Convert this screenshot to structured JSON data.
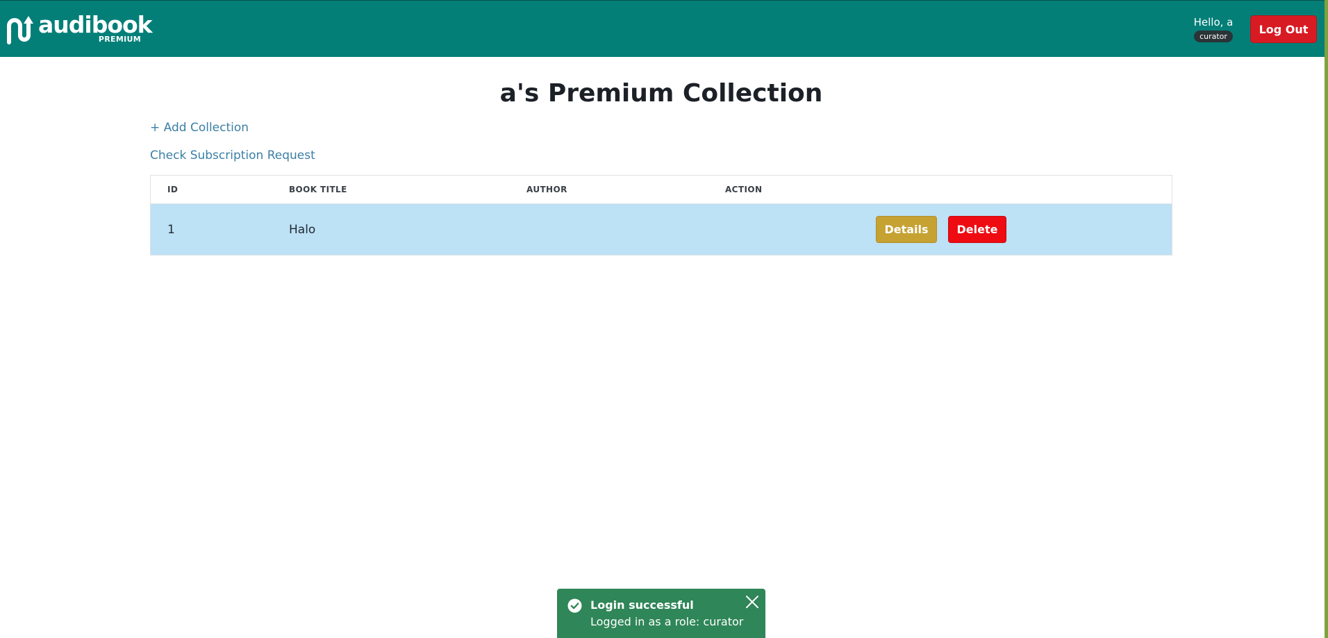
{
  "header": {
    "brand_name": "audibook",
    "brand_sub": "PREMIUM",
    "greeting": "Hello, a",
    "role_badge": "curator",
    "logout_label": "Log Out"
  },
  "main": {
    "title": "a's Premium Collection",
    "add_collection_link": "+ Add Collection",
    "check_subscription_link": "Check Subscription Request"
  },
  "table": {
    "columns": [
      "ID",
      "BOOK TITLE",
      "AUTHOR",
      "ACTION"
    ],
    "rows": [
      {
        "id": "1",
        "title": "Halo",
        "author": "",
        "details_label": "Details",
        "delete_label": "Delete"
      }
    ]
  },
  "toast": {
    "title": "Login successful",
    "message": "Logged in as a role: curator"
  },
  "colors": {
    "navbar": "#037f78",
    "logout_button": "#d81b23",
    "row_highlight": "#bde1f5",
    "details_button": "#c6a233",
    "delete_button": "#ee0b12",
    "toast": "#2f8658",
    "link": "#3a7fa6"
  }
}
